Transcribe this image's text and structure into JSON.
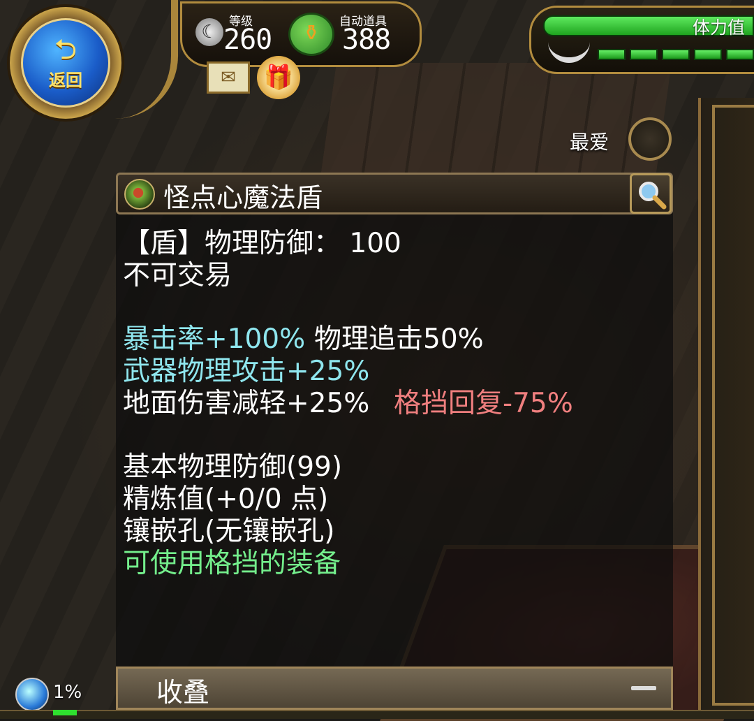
{
  "header": {
    "back_label": "返回",
    "level_label": "等级",
    "level_value": "260",
    "auto_item_label": "自动道具",
    "auto_item_value": "388",
    "stamina_label": "体力值"
  },
  "favorite_label": "最爱",
  "item": {
    "name": "怪点心魔法盾",
    "lines": [
      {
        "text": "【盾】物理防御： 100",
        "color": "white"
      },
      {
        "text": "不可交易",
        "color": "white"
      },
      {
        "text": "暴击率+100%",
        "color": "cyan"
      },
      {
        "text": "物理追击50%",
        "color": "white"
      },
      {
        "text": "武器物理攻击+25%",
        "color": "cyan"
      },
      {
        "text": "地面伤害减轻+25%",
        "color": "white"
      },
      {
        "text": "格挡回复-75%",
        "color": "red"
      },
      {
        "text": "基本物理防御(99)",
        "color": "white"
      },
      {
        "text": "精炼值(+0/0 点)",
        "color": "white"
      },
      {
        "text": "镶嵌孔(无镶嵌孔)",
        "color": "white"
      },
      {
        "text": "可使用格挡的装备",
        "color": "green"
      }
    ]
  },
  "collapse_label": "收叠",
  "exp_percent": "1%",
  "icons": {
    "back": "return-arrow-icon",
    "level": "crescent-icon",
    "auto_item": "potion-pot-icon",
    "mail": "mail-icon",
    "gift": "gift-icon",
    "favorite": "favorite-circle-icon",
    "item": "shield-icon",
    "search": "magnifier-icon",
    "collapse": "minus-icon",
    "exp": "orb-icon"
  },
  "colors": {
    "cyan": "#8fe6ee",
    "red": "#f07f7f",
    "green": "#74ee8c",
    "gold": "#b28c3e",
    "stamina": "#2fcf2f"
  }
}
